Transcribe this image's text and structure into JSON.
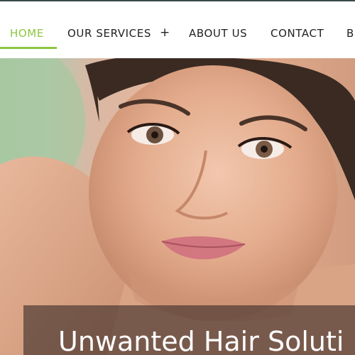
{
  "nav": {
    "items": [
      {
        "label": "HOME",
        "active": true
      },
      {
        "label": "OUR SERVICES"
      },
      {
        "label": "ABOUT US"
      },
      {
        "label": "CONTACT"
      },
      {
        "label": "B"
      }
    ],
    "services_expand_symbol": "+",
    "active_color": "#8cc63f",
    "text_color": "#222222"
  },
  "hero": {
    "image": "smiling-woman-photo",
    "caption": "Unwanted Hair Soluti"
  }
}
